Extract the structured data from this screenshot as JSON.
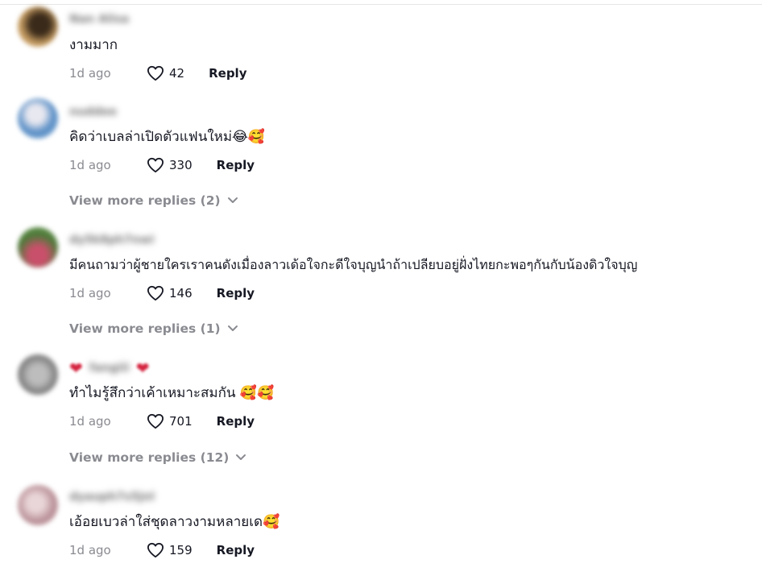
{
  "comments": [
    {
      "username": "Nan Alisa",
      "text": "งามมาก",
      "time": "1d ago",
      "likes": "42",
      "reply_label": "Reply",
      "avatar_color": "#b08a55"
    },
    {
      "username": "nuddee",
      "text": "คิดว่าเบลล่าเปิดตัวแฟนใหม่😂🥰",
      "time": "1d ago",
      "likes": "330",
      "reply_label": "Reply",
      "view_more": "View more replies (2)",
      "avatar_color": "#6a9ac4"
    },
    {
      "username": "dy5k8ph7nwi",
      "text": "มีคนถามว่าผู้ชายใครเราคนดังเมื่องลาวเด้อใจกะดีใจบุญนำถ้าเปลียบอยู่ฝั่งไทยกะพอๆกันกับน้องดิวใจบุญ",
      "time": "1d ago",
      "likes": "146",
      "reply_label": "Reply",
      "view_more": "View more replies (1)",
      "avatar_color": "#6d8a5a"
    },
    {
      "username": "fangiii",
      "text": "ทำไมรู้สึกว่าเค้าเหมาะสมกัน 🥰🥰",
      "time": "1d ago",
      "likes": "701",
      "reply_label": "Reply",
      "view_more": "View more replies (12)",
      "avatar_color": "#8c8c8c"
    },
    {
      "username": "dyauph7s5jnl",
      "text": "เอ้อยเบวล่าใส่ชุดลาวงามหลายเด🥰",
      "time": "1d ago",
      "likes": "159",
      "reply_label": "Reply",
      "avatar_color": "#c9a3a8"
    }
  ]
}
